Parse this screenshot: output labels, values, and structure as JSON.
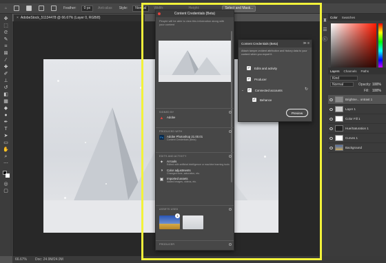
{
  "app": {
    "title": "Adobe Photoshop 2021"
  },
  "options_bar": {
    "feather_label": "Feather:",
    "feather_value": "0 px",
    "anti_alias": "Anti-alias",
    "style_label": "Style:",
    "style_value": "Normal",
    "width_label": "Width:",
    "height_label": "Height:",
    "select_mask": "Select and Mask..."
  },
  "document": {
    "tab_title": "AdobeStock_51134478 @ 66.67% (Layer 0, RGB/8)",
    "zoom": "66.67%",
    "doc_size": "Doc: 24.9M/24.9M"
  },
  "right_panel": {
    "color_tabs": [
      "Color",
      "Swatches"
    ],
    "layers_tabs": [
      "Layers",
      "Channels",
      "Paths"
    ],
    "kind": "Kind",
    "blend_mode": "Normal",
    "opacity_label": "Opacity:",
    "opacity_value": "100%",
    "fill_label": "Fill:",
    "fill_value": "100%",
    "layers": [
      {
        "name": "Brightne... ontrast 1"
      },
      {
        "name": "Layer 1"
      },
      {
        "name": "Color Fill 1"
      },
      {
        "name": "Hue/Saturation 1"
      },
      {
        "name": "Curves 1"
      },
      {
        "name": "Background"
      }
    ]
  },
  "content_credentials": {
    "title": "Content Credentials (Beta)",
    "intro": "People will be able to view this information along with your content",
    "signed_by": {
      "caption": "SIGNED BY",
      "name": "Adobe"
    },
    "produced_with": {
      "caption": "PRODUCED WITH",
      "app": "Adobe Photoshop 21.00.01",
      "sub": "Content Credentials (Beta)"
    },
    "edits": {
      "caption": "EDITS AND ACTIVITY",
      "items": [
        {
          "title": "AI tools",
          "desc": "Edited with artificial intelligence or machine learning tools"
        },
        {
          "title": "Color adjustments",
          "desc": "Changed tone, saturation, etc."
        },
        {
          "title": "Imported assets",
          "desc": "Added images, videos, etc."
        }
      ]
    },
    "assets_used": {
      "caption": "ASSETS USED",
      "badge": "1"
    },
    "producer": {
      "caption": "PRODUCER"
    }
  },
  "popover": {
    "title": "Content Credentials (Beta)",
    "description": "Attach tamper-evident attribution and history data to your content when you export it.",
    "options": [
      {
        "label": "Edits and activity",
        "checked": true
      },
      {
        "label": "Producer",
        "checked": true
      },
      {
        "label": "Connected accounts",
        "checked": true
      },
      {
        "label": "Behance",
        "checked": true
      }
    ],
    "preview_button": "Preview"
  },
  "colors": {
    "highlight": "#f2f23a",
    "accent_red": "#e0443e"
  }
}
